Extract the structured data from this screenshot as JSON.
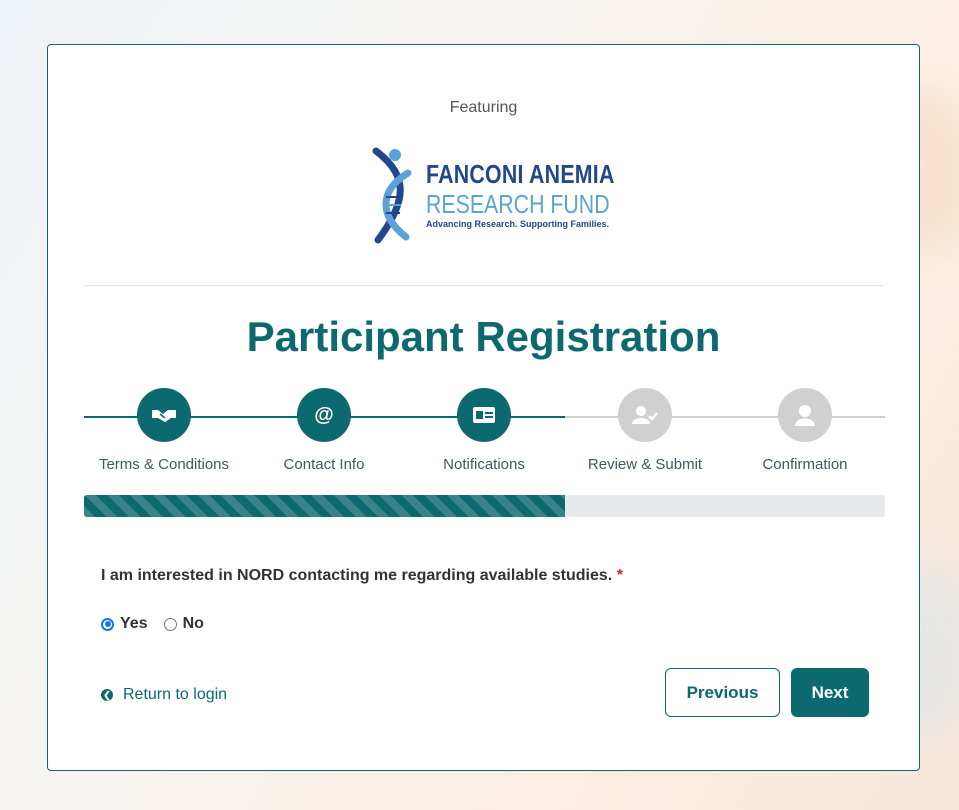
{
  "header": {
    "featuring": "Featuring"
  },
  "logo": {
    "line1": "FANCONI ANEMIA",
    "line2": "RESEARCH FUND",
    "tagline": "Advancing Research. Supporting Families."
  },
  "page": {
    "title": "Participant Registration"
  },
  "steps": [
    {
      "label": "Terms & Conditions",
      "icon": "handshake-icon",
      "status": "complete"
    },
    {
      "label": "Contact Info",
      "icon": "at-icon",
      "status": "complete"
    },
    {
      "label": "Notifications",
      "icon": "id-card-icon",
      "status": "current"
    },
    {
      "label": "Review & Submit",
      "icon": "user-check-icon",
      "status": "pending"
    },
    {
      "label": "Confirmation",
      "icon": "user-icon",
      "status": "pending"
    }
  ],
  "progress": {
    "percent": 60
  },
  "form": {
    "question": "I am interested in NORD contacting me regarding available studies.",
    "required_mark": "*",
    "options": [
      {
        "label": "Yes",
        "checked": true
      },
      {
        "label": "No",
        "checked": false
      }
    ]
  },
  "nav": {
    "return_label": "Return to login",
    "previous_label": "Previous",
    "next_label": "Next"
  },
  "colors": {
    "accent": "#0d6970",
    "inactive": "#d0d0d0",
    "required": "#d9251d"
  }
}
